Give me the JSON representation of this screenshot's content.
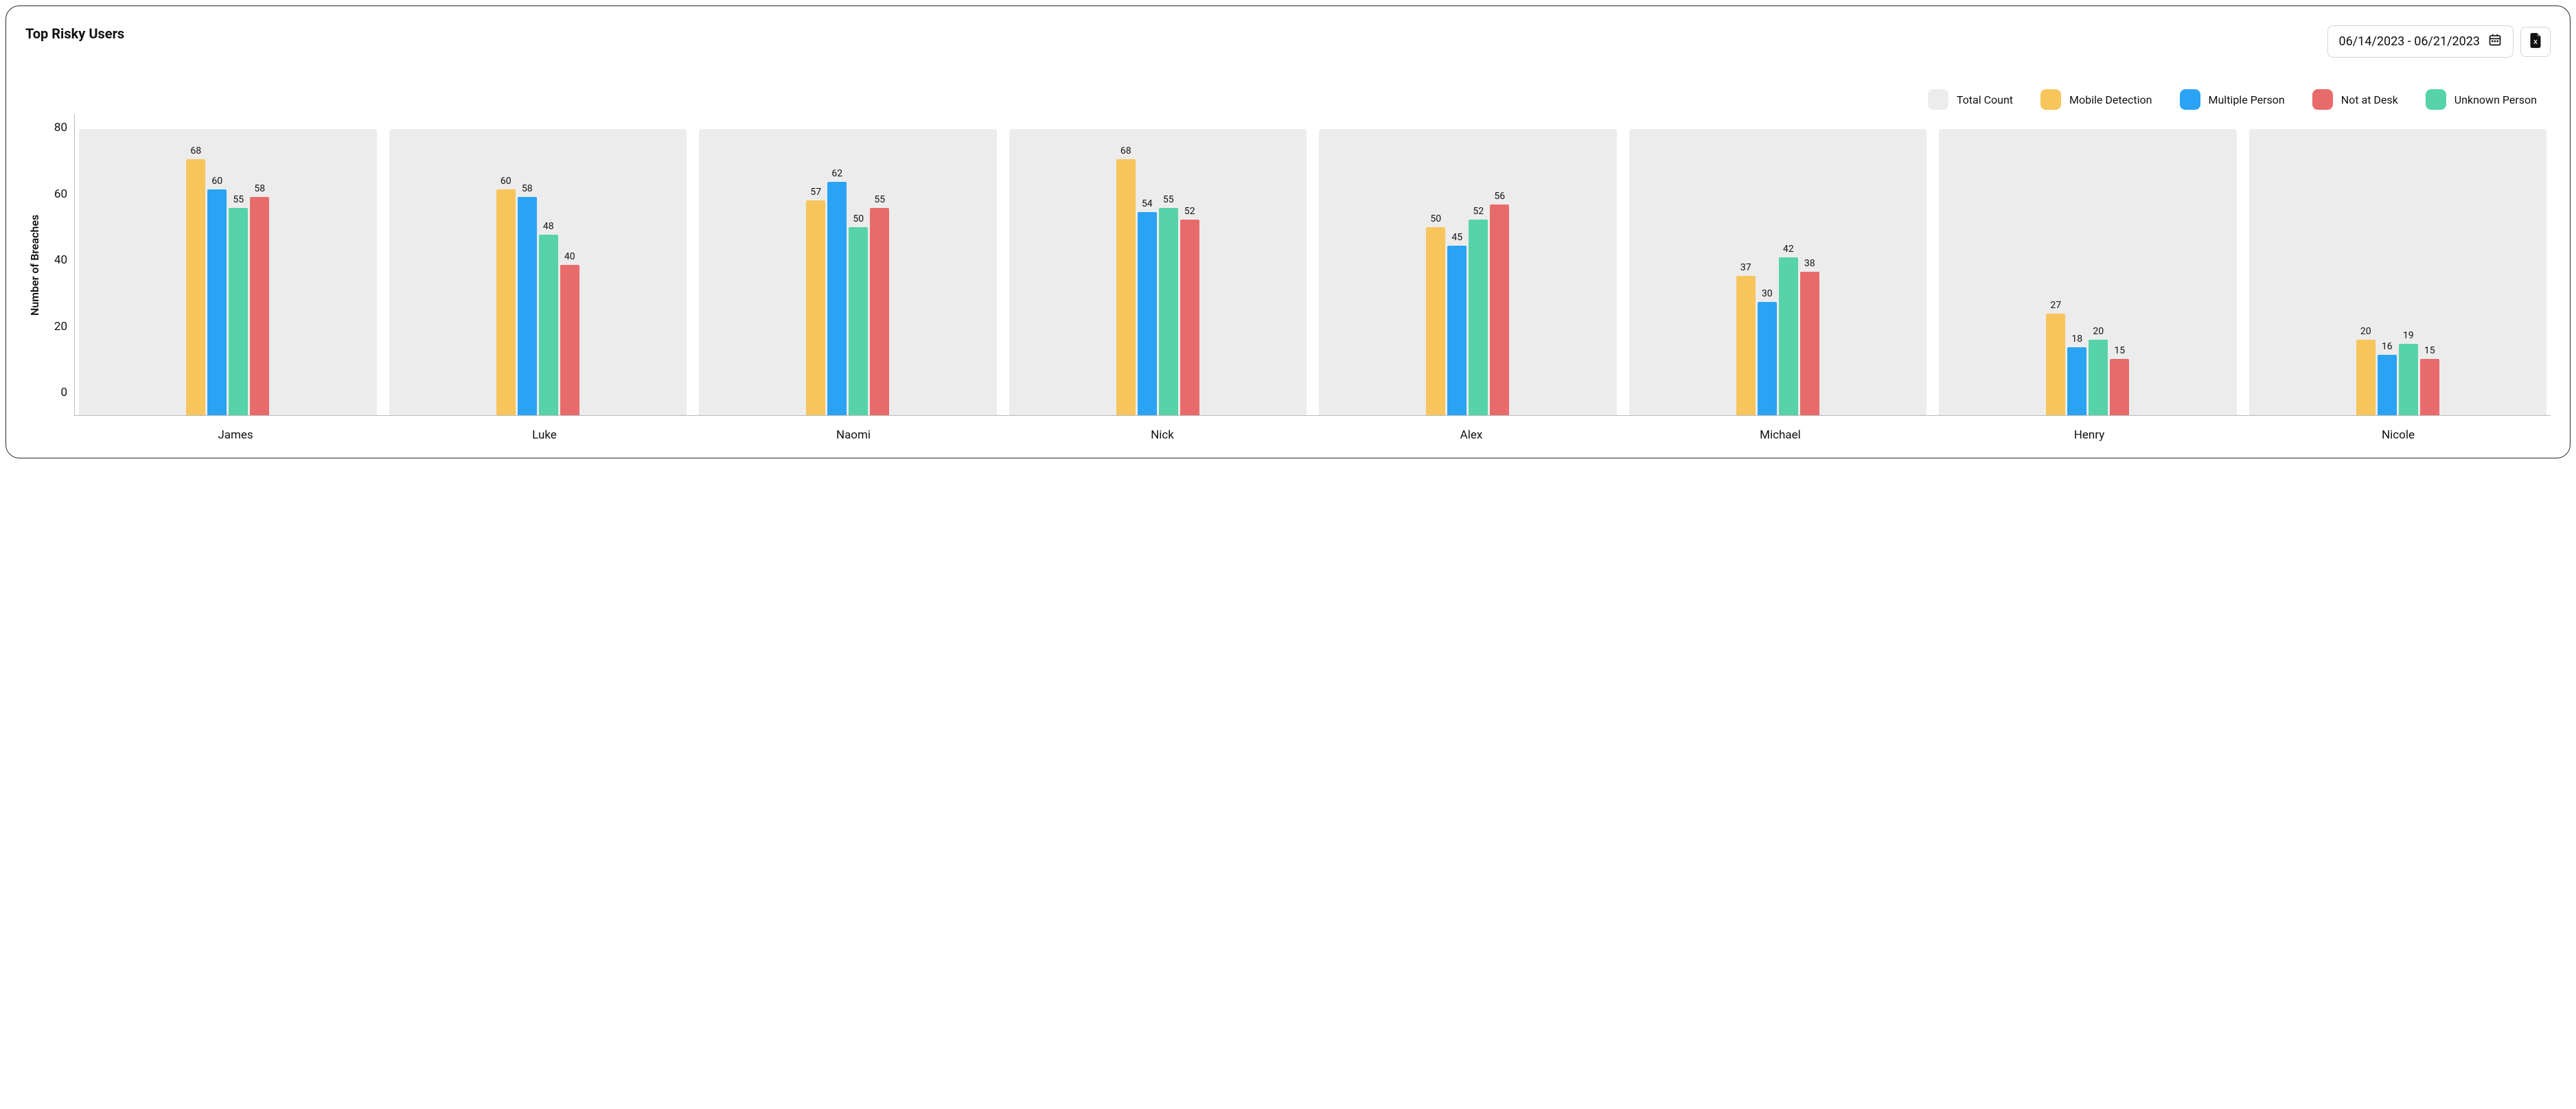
{
  "title": "Top Risky Users",
  "date_range": "06/14/2023 - 06/21/2023",
  "ylabel": "Number of Breaches",
  "legend": [
    {
      "label": "Total Count",
      "color": "#ececec"
    },
    {
      "label": "Mobile Detection",
      "color": "#f7c55b"
    },
    {
      "label": "Multiple Person",
      "color": "#2aa3f4"
    },
    {
      "label": "Not at Desk",
      "color": "#e86b6b"
    },
    {
      "label": "Unknown Person",
      "color": "#56d3a8"
    }
  ],
  "chart_data": {
    "type": "bar",
    "categories": [
      "James",
      "Luke",
      "Naomi",
      "Nick",
      "Alex",
      "Michael",
      "Henry",
      "Nicole"
    ],
    "series": [
      {
        "name": "Mobile Detection",
        "color": "#f7c55b",
        "values": [
          68,
          60,
          57,
          68,
          50,
          37,
          27,
          20
        ]
      },
      {
        "name": "Multiple Person",
        "color": "#2aa3f4",
        "values": [
          60,
          58,
          62,
          54,
          45,
          30,
          18,
          16
        ]
      },
      {
        "name": "Unknown Person",
        "color": "#56d3a8",
        "values": [
          55,
          48,
          50,
          55,
          52,
          42,
          20,
          19
        ]
      },
      {
        "name": "Not at Desk",
        "color": "#e86b6b",
        "values": [
          58,
          40,
          55,
          52,
          56,
          38,
          15,
          15
        ]
      }
    ],
    "total_height": 76,
    "ylabel": "Number of Breaches",
    "xlabel": "",
    "ylim": [
      0,
      80
    ],
    "yticks": [
      80,
      60,
      40,
      20,
      0
    ]
  }
}
